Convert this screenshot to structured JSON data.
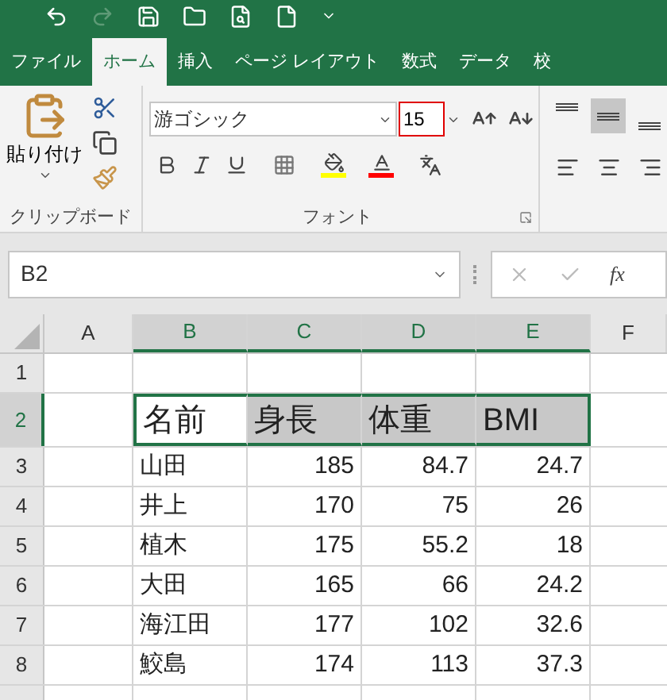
{
  "quick_access": [
    {
      "kind": "undo",
      "disabled": false
    },
    {
      "kind": "redo",
      "disabled": true
    },
    {
      "kind": "save",
      "disabled": false
    },
    {
      "kind": "open",
      "disabled": false
    },
    {
      "kind": "preview",
      "disabled": false
    },
    {
      "kind": "new",
      "disabled": false
    },
    {
      "kind": "customize",
      "disabled": false
    }
  ],
  "tabs": [
    {
      "label": "ファイル",
      "selected": false
    },
    {
      "label": "ホーム",
      "selected": true
    },
    {
      "label": "挿入",
      "selected": false
    },
    {
      "label": "ページ レイアウト",
      "selected": false
    },
    {
      "label": "数式",
      "selected": false
    },
    {
      "label": "データ",
      "selected": false
    },
    {
      "label": "校",
      "selected": false
    }
  ],
  "clipboard": {
    "paste_label": "貼り付け",
    "group_label": "クリップボード"
  },
  "font": {
    "name": "游ゴシック",
    "size": "15",
    "group_label": "フォント"
  },
  "vertical_align": [
    {
      "selected": false
    },
    {
      "selected": true
    },
    {
      "selected": false
    }
  ],
  "horizontal_align": [
    {
      "selected": false
    },
    {
      "selected": false
    },
    {
      "selected": false
    }
  ],
  "name_box": "B2",
  "formula_bar": {
    "fx": "fx"
  },
  "columns": [
    {
      "label": "A",
      "selected": false
    },
    {
      "label": "B",
      "selected": true
    },
    {
      "label": "C",
      "selected": true
    },
    {
      "label": "D",
      "selected": true
    },
    {
      "label": "E",
      "selected": true
    },
    {
      "label": "F",
      "selected": false
    }
  ],
  "rows": [
    {
      "number": "1",
      "selected": false,
      "kind": "empty",
      "cells": []
    },
    {
      "number": "2",
      "selected": true,
      "kind": "header",
      "cells": [
        {
          "text": "名前",
          "filled": false
        },
        {
          "text": "身長",
          "filled": true
        },
        {
          "text": "体重",
          "filled": true
        },
        {
          "text": "BMI",
          "filled": true
        }
      ]
    },
    {
      "number": "3",
      "selected": false,
      "kind": "data",
      "cells": [
        {
          "text": "山田"
        },
        {
          "text": "185"
        },
        {
          "text": "84.7"
        },
        {
          "text": "24.7"
        }
      ]
    },
    {
      "number": "4",
      "selected": false,
      "kind": "data",
      "cells": [
        {
          "text": "井上"
        },
        {
          "text": "170"
        },
        {
          "text": "75"
        },
        {
          "text": "26"
        }
      ]
    },
    {
      "number": "5",
      "selected": false,
      "kind": "data",
      "cells": [
        {
          "text": "植木"
        },
        {
          "text": "175"
        },
        {
          "text": "55.2"
        },
        {
          "text": "18"
        }
      ]
    },
    {
      "number": "6",
      "selected": false,
      "kind": "data",
      "cells": [
        {
          "text": "大田"
        },
        {
          "text": "165"
        },
        {
          "text": "66"
        },
        {
          "text": "24.2"
        }
      ]
    },
    {
      "number": "7",
      "selected": false,
      "kind": "data",
      "cells": [
        {
          "text": "海江田"
        },
        {
          "text": "177"
        },
        {
          "text": "102"
        },
        {
          "text": "32.6"
        }
      ]
    },
    {
      "number": "8",
      "selected": false,
      "kind": "data",
      "cells": [
        {
          "text": "鮫島"
        },
        {
          "text": "174"
        },
        {
          "text": "113"
        },
        {
          "text": "37.3"
        }
      ]
    }
  ]
}
